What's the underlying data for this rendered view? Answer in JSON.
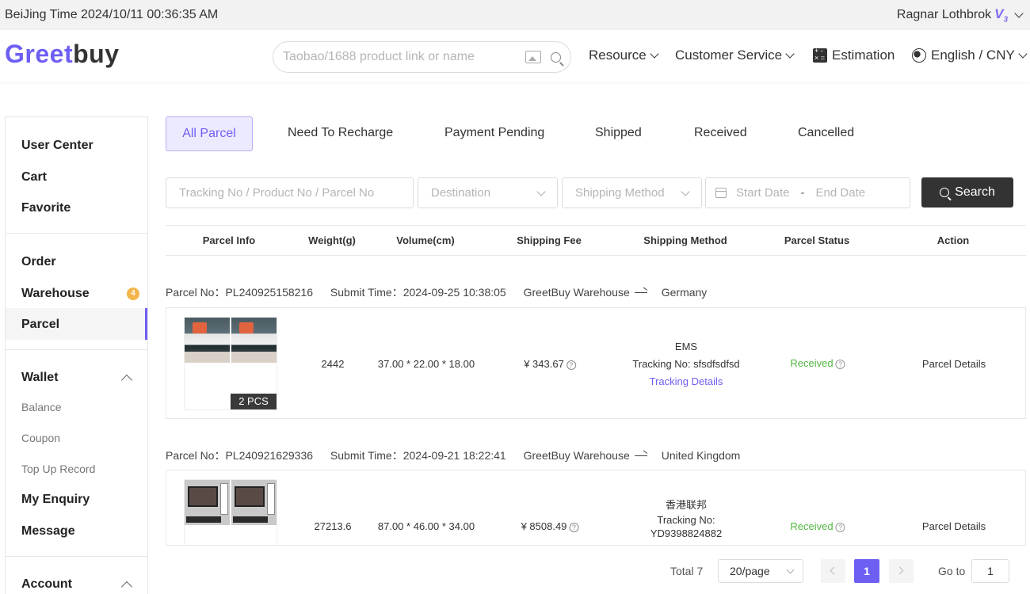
{
  "topbar": {
    "time": "BeiJing Time 2024/10/11 00:36:35 AM",
    "username": "Ragnar Lothbrok",
    "vip_level": "V",
    "vip_sub": "3"
  },
  "header": {
    "logo_a": "Greet",
    "logo_b": "buy",
    "search_placeholder": "Taobao/1688 product link or name",
    "nav": {
      "resource": "Resource",
      "customer_service": "Customer Service",
      "estimation": "Estimation",
      "language": "English / CNY"
    }
  },
  "sidebar": {
    "user_center": "User Center",
    "cart": "Cart",
    "favorite": "Favorite",
    "order": "Order",
    "warehouse": "Warehouse",
    "warehouse_badge": "4",
    "parcel": "Parcel",
    "wallet": "Wallet",
    "balance": "Balance",
    "coupon": "Coupon",
    "top_up_record": "Top Up Record",
    "my_enquiry": "My Enquiry",
    "message": "Message",
    "account": "Account"
  },
  "tabs": [
    "All Parcel",
    "Need To Recharge",
    "Payment Pending",
    "Shipped",
    "Received",
    "Cancelled"
  ],
  "filters": {
    "keyword_placeholder": "Tracking No / Product No / Parcel No",
    "destination": "Destination",
    "shipping_method": "Shipping Method",
    "start_date": "Start Date",
    "date_sep": "-",
    "end_date": "End Date",
    "search": "Search"
  },
  "table": {
    "headers": [
      "Parcel Info",
      "Weight(g)",
      "Volume(cm)",
      "Shipping Fee",
      "Shipping Method",
      "Parcel Status",
      "Action"
    ]
  },
  "parcels": [
    {
      "parcel_no": "Parcel No：PL240925158216",
      "submit_time": "Submit Time：2024-09-25 10:38:05",
      "from": "GreetBuy Warehouse",
      "to": "Germany",
      "pcs": "2 PCS",
      "weight": "2442",
      "volume": "37.00 * 22.00 * 18.00",
      "fee": "¥ 343.67",
      "method": "EMS",
      "tracking": "Tracking No: sfsdfsdfsd",
      "tracking_link": "Tracking Details",
      "status": "Received",
      "action": "Parcel Details"
    },
    {
      "parcel_no": "Parcel No：PL240921629336",
      "submit_time": "Submit Time：2024-09-21 18:22:41",
      "from": "GreetBuy Warehouse",
      "to": "United Kingdom",
      "weight": "27213.6",
      "volume": "87.00 * 46.00 * 34.00",
      "fee": "¥ 8508.49",
      "method": "香港联邦",
      "tracking_label": "Tracking No:",
      "tracking_no": "YD9398824882",
      "status": "Received",
      "action": "Parcel Details"
    }
  ],
  "pagination": {
    "total": "Total 7",
    "page_size": "20/page",
    "current": "1",
    "goto_label": "Go to",
    "goto_value": "1"
  },
  "colors": {
    "accent": "#6e5ff3",
    "received": "#52b541",
    "badge": "#f3b54a"
  }
}
